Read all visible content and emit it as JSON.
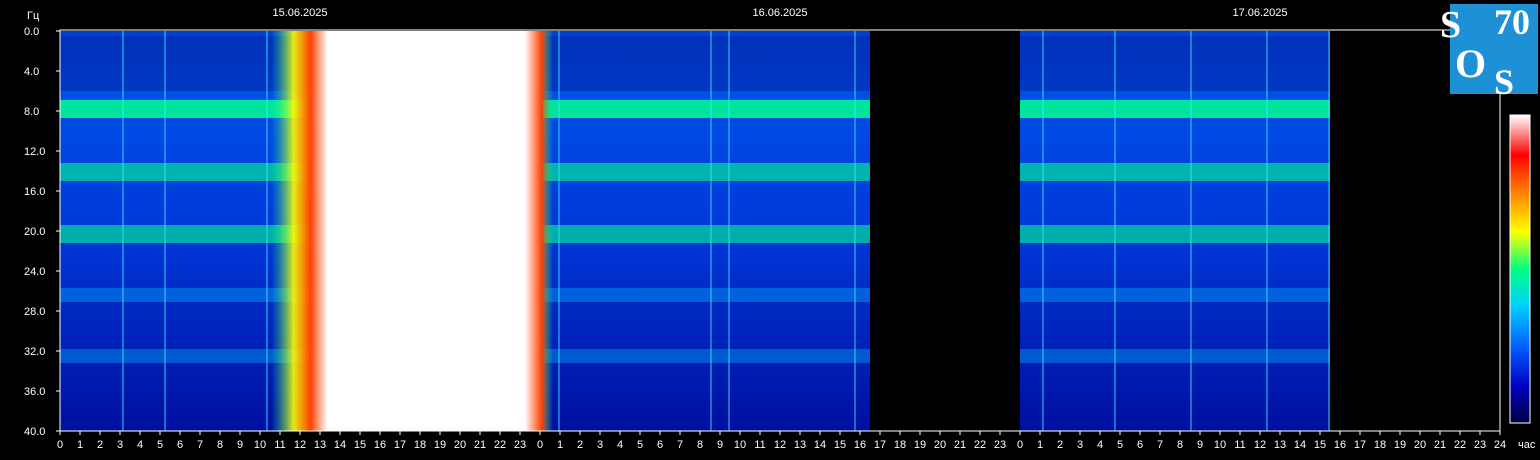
{
  "chart_data": {
    "type": "heatmap",
    "title": "",
    "ylabel": "Гц",
    "xlabel": "час",
    "ylim": [
      0,
      40
    ],
    "y_ticks": [
      "0.0",
      "4.0",
      "8.0",
      "12.0",
      "16.0",
      "20.0",
      "24.0",
      "28.0",
      "32.0",
      "36.0",
      "40.0"
    ],
    "dates": [
      "15.06.2025",
      "16.06.2025",
      "17.06.2025"
    ],
    "x_ticks": [
      "0",
      "1",
      "2",
      "3",
      "4",
      "5",
      "6",
      "7",
      "8",
      "9",
      "10",
      "11",
      "12",
      "13",
      "14",
      "15",
      "16",
      "17",
      "18",
      "19",
      "20",
      "21",
      "22",
      "23",
      "0",
      "1",
      "2",
      "3",
      "4",
      "5",
      "6",
      "7",
      "8",
      "9",
      "10",
      "11",
      "12",
      "13",
      "14",
      "15",
      "16",
      "17",
      "18",
      "19",
      "20",
      "21",
      "22",
      "23",
      "0",
      "1",
      "2",
      "3",
      "4",
      "5",
      "6",
      "7",
      "8",
      "9",
      "10",
      "11",
      "12",
      "13",
      "14",
      "15",
      "16",
      "17",
      "18",
      "19",
      "20",
      "21",
      "22",
      "23",
      "24"
    ],
    "x_range_hours": [
      0,
      72
    ],
    "data_gap_hours": [
      40.5,
      48
    ],
    "data_end_hours": 63.5,
    "saturation_band_hours": [
      11.8,
      23.4
    ],
    "resonance_bands_hz": [
      7.8,
      14.1,
      20.3,
      26.4,
      32.5
    ],
    "colorscale": [
      "#000040",
      "#0000c0",
      "#0060ff",
      "#00c0ff",
      "#00ff80",
      "#ffff00",
      "#ff8000",
      "#ff0000",
      "#ffffff"
    ],
    "grid": false,
    "legend": "colorbar-right"
  },
  "logo": {
    "text": [
      "S",
      "70",
      "O",
      "S"
    ],
    "background": "#1e90d6"
  },
  "colors": {
    "background": "#000000",
    "axis": "#ffffff",
    "low": "#0000b0",
    "band": "#00ff90",
    "saturated": "#ffffff"
  }
}
